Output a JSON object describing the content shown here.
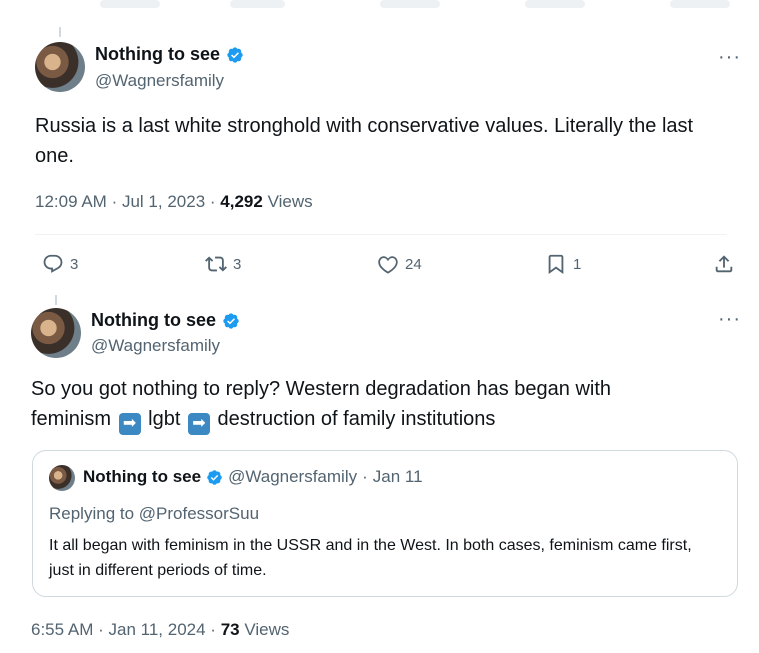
{
  "tweet1": {
    "display_name": "Nothing to see",
    "handle": "@Wagnersfamily",
    "more": "···",
    "text": "Russia is a last white stronghold with conservative values. Literally the last one.",
    "time": "12:09 AM",
    "sep1": "·",
    "date": "Jul 1, 2023",
    "sep2": "·",
    "views_count": "4,292",
    "views_label": "Views",
    "actions": {
      "replies": "3",
      "reposts": "3",
      "likes": "24",
      "bookmarks": "1"
    },
    "icons": [
      "reply-icon",
      "repost-icon",
      "like-icon",
      "bookmark-icon",
      "share-icon"
    ]
  },
  "tweet2": {
    "display_name": "Nothing to see",
    "handle": "@Wagnersfamily",
    "more": "···",
    "text_part1": "So you got nothing to reply? Western degradation has began with",
    "text_part2": "feminism",
    "text_part3": "lgbt",
    "text_part4": "destruction of family institutions",
    "arrow_emoji": "➡",
    "time": "6:55 AM",
    "sep1": "·",
    "date": "Jan 11, 2024",
    "sep2": "·",
    "views_count": "73",
    "views_label": "Views"
  },
  "quoted": {
    "display_name": "Nothing to see",
    "handle": "@Wagnersfamily",
    "sep": "·",
    "date": "Jan 11",
    "replying_to": "Replying to @ProfessorSuu",
    "text": "It all began with feminism in the USSR and in the West. In both cases, feminism came first, just in different periods of time."
  },
  "colors": {
    "verified": "#1d9bf0",
    "secondary_text": "#536471",
    "primary_text": "#0f1419",
    "border": "#cfd9de"
  }
}
